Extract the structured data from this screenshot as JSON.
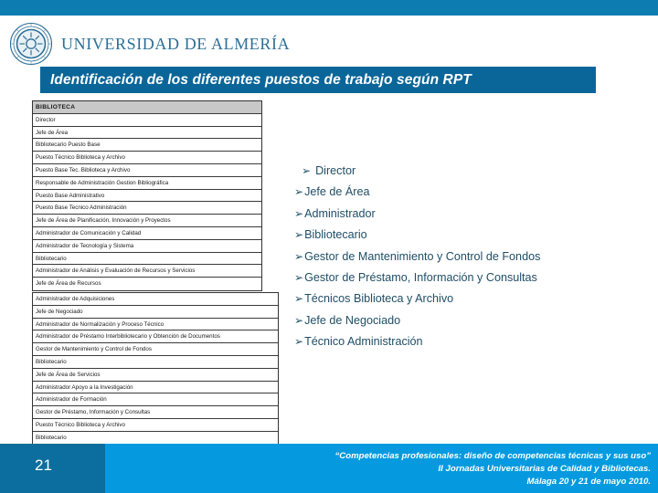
{
  "header": {
    "university_name": "UNIVERSIDAD DE ALMERÍA",
    "logo_icon": "university-seal-icon",
    "title": "Identificación de los diferentes puestos de trabajo según RPT",
    "topbar_color": "#0d7cb0",
    "banner_color": "#0a6699"
  },
  "rpt_table": {
    "block_1": {
      "header": "BIBLIOTECA",
      "rows": [
        "Director",
        "Jefe de Área",
        "Bibliotecario Puesto Base",
        "Puesto Técnico Biblioteca y Archivo",
        "Puesto Base Tec. Biblioteca y Archivo",
        "Responsable de Administración Gestion Bibliográfica",
        "Puesto Base  Administrativo",
        "Puesto Base Tecnico Administración",
        "Jefe de Área de Planificación, Innovación y Proyectos",
        "Administrador de Comunicación y Calidad",
        "Administrador de Tecnología  y Sistema",
        "Bibliotecario",
        "Administrador de Análisis y Evaluación de Recursos y Servicios",
        "Jefe de Área de Recursos"
      ]
    },
    "block_2": {
      "rows": [
        "Administrador de Adquisiciones",
        "Jefe de Negociado",
        "Administrador de Normalización y Proceso Técnico",
        "Administrador de Préstamo Interbibliotecario y Obtención de Documentos",
        "Gestor de Mantenimiento y Control de Fondos",
        "Bibliotecario",
        "Jefe de Área de Servicios",
        "Administrador Apoyo a la Investigación",
        "Administrador de Formación",
        "Gestor de Préstamo, Información y Consultas",
        "Puesto Técnico Biblioteca y Archivo",
        "Bibliotecario"
      ]
    }
  },
  "bullet_list": {
    "marker": "➢",
    "text_color": "#1f4e66",
    "items": [
      "Director",
      "Jefe de Área",
      "Administrador",
      "Bibliotecario",
      "Gestor de Mantenimiento y Control de Fondos",
      "Gestor de Préstamo, Información y Consultas",
      "Técnicos Biblioteca y Archivo",
      "Jefe de Negociado",
      "Técnico Administración"
    ]
  },
  "footer": {
    "slide_number": "21",
    "line_1": "“Competencias profesionales: diseño de competencias técnicas y sus uso”",
    "line_2": "II Jornadas Universitarias de Calidad y Bibliotecas.",
    "line_3": "Málaga 20 y 21 de mayo 2010.",
    "left_color": "#0b6e9e",
    "right_color": "#059ae0"
  }
}
